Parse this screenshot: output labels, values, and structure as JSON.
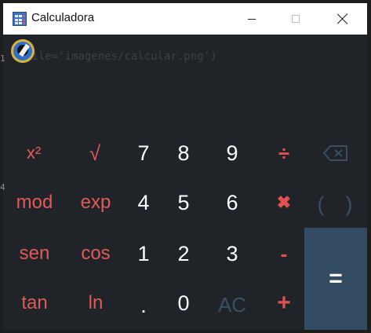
{
  "window": {
    "title": "Calculadora"
  },
  "background_text": "file='imagenes/calcular.png')",
  "edge_marks": [
    "1",
    "4"
  ],
  "keys": {
    "square": "x²",
    "sqrt": "√",
    "seven": "7",
    "eight": "8",
    "nine": "9",
    "divide": "÷",
    "mod": "mod",
    "exp": "exp",
    "four": "4",
    "five": "5",
    "six": "6",
    "multiply": "✖",
    "open_paren": "(",
    "close_paren": ")",
    "sen": "sen",
    "cos": "cos",
    "one": "1",
    "two": "2",
    "three": "3",
    "minus": "-",
    "tan": "tan",
    "ln": "ln",
    "dot": ".",
    "zero": "0",
    "clear": "AC",
    "plus": "+",
    "equals": "="
  },
  "colors": {
    "background": "#202428",
    "function_key": "#e05a58",
    "operator_key": "#e0514f",
    "digit_key": "#ffffff",
    "disabled_key": "#3a4e66",
    "equals_bg": "#344c63"
  },
  "icons": {
    "app": "calculator-icon",
    "logo": "flash-camera-icon",
    "backspace": "backspace-icon"
  }
}
